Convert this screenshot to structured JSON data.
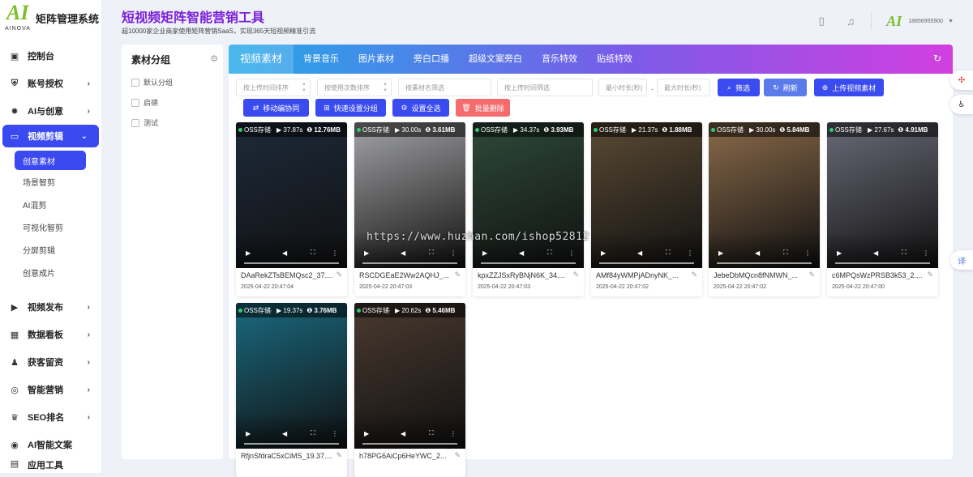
{
  "app": {
    "name": "矩阵管理系统",
    "logo_text": "AI",
    "logo_sub": "AINOVA"
  },
  "header": {
    "title": "短视频矩阵智能营销工具",
    "subtitle": "超10000家企业商家使用矩阵营销SaaS，实现365天短视频精准引流",
    "phone": "18856955900",
    "avatar_text": "AI"
  },
  "nav": [
    {
      "label": "控制台",
      "icon": "monitor-icon",
      "has_children": false
    },
    {
      "label": "账号授权",
      "icon": "shield-icon",
      "has_children": true
    },
    {
      "label": "AI与创意",
      "icon": "bulb-icon",
      "has_children": true
    },
    {
      "label": "视频剪辑",
      "icon": "video-icon",
      "has_children": true,
      "active": true
    }
  ],
  "subnav": [
    "创意素材",
    "场景智剪",
    "AI混剪",
    "可视化智剪",
    "分屏剪辑",
    "创意成片"
  ],
  "nav2": [
    {
      "label": "视频发布",
      "icon": "video-play-icon"
    },
    {
      "label": "数据看板",
      "icon": "dashboard-icon"
    },
    {
      "label": "获客留资",
      "icon": "users-icon"
    },
    {
      "label": "智能营销",
      "icon": "target-icon"
    },
    {
      "label": "SEO排名",
      "icon": "crown-icon"
    },
    {
      "label": "AI智能文案",
      "icon": "chat-icon"
    }
  ],
  "nav_last": "应用工具",
  "groups": {
    "title": "素材分组",
    "items": [
      "默认分组",
      "启德",
      "测试"
    ]
  },
  "tabs": [
    "视频素材",
    "背景音乐",
    "图片素材",
    "旁白口播",
    "超级文案旁白",
    "音乐特效",
    "贴纸特效"
  ],
  "filters": {
    "upload_sort": "按上传时间排序",
    "use_sort": "按使用次数排序",
    "name": "按素材名筛选",
    "upload_filter": "按上传时间筛选",
    "min_dur": "最小时长(秒)",
    "max_dur": "最大时长(秒)",
    "dash": "-"
  },
  "buttons": {
    "filter": "筛选",
    "refresh": "刷新",
    "upload": "上传视频素材",
    "move": "移动编协同",
    "quick_group": "快速设置分组",
    "select_all": "设置全选",
    "batch_delete": "批量删除"
  },
  "storage_label": "OSS存储-",
  "videos": [
    {
      "dur": "37.87s",
      "size": "12.76MB",
      "name": "DAaRekZTsBEMQsc2_37....",
      "date": "2025-04-22 20:47:04",
      "color": "#1d2a3a"
    },
    {
      "dur": "30.00s",
      "size": "3.61MB",
      "name": "RSCDGEaE2Ww2AQHJ_...",
      "date": "2025-04-22 20:47:03",
      "color": "#a3a4a6"
    },
    {
      "dur": "34.37s",
      "size": "3.93MB",
      "name": "kpxZZJSxRyBNjN6K_34....",
      "date": "2025-04-22 20:47:03",
      "color": "#2e4a3a"
    },
    {
      "dur": "21.37s",
      "size": "1.88MB",
      "name": "AMf84yWMPjADnyNK_...",
      "date": "2025-04-22 20:47:02",
      "color": "#5a4a34"
    },
    {
      "dur": "30.00s",
      "size": "5.84MB",
      "name": "JebeDbMQcn8fNMWN_...",
      "date": "2025-04-22 20:47:02",
      "color": "#8a6a4a"
    },
    {
      "dur": "27.67s",
      "size": "4.91MB",
      "name": "c6MPQsWzPRSB3k53_2....",
      "date": "2025-04-22 20:47:00",
      "color": "#6a6a78"
    },
    {
      "dur": "19.37s",
      "size": "3.76MB",
      "name": "RfjnSfdraC5xCiMS_19.37....",
      "date": "",
      "color": "#1a6a80"
    },
    {
      "dur": "20.62s",
      "size": "5.46MB",
      "name": "h78PG6AiCp6HeYWC_2...",
      "date": "",
      "color": "#4a3a30"
    }
  ],
  "watermark": "https://www.huzhan.com/ishop52812",
  "float_buttons": [
    "logo-icon",
    "accessibility-icon",
    "translate-icon"
  ],
  "translate_label": "译"
}
